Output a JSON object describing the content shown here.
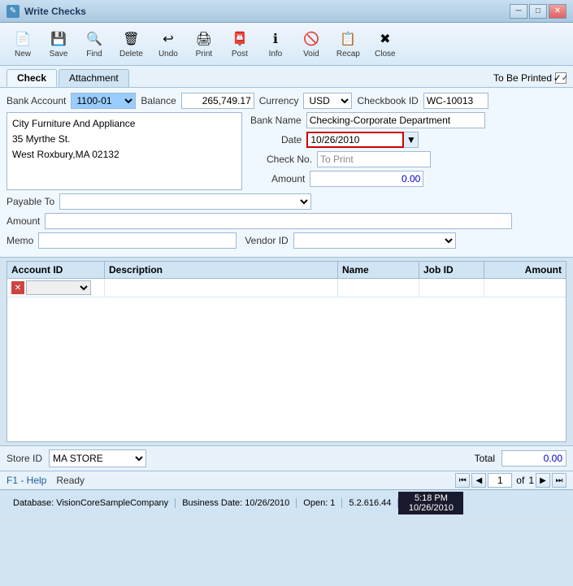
{
  "window": {
    "title": "Write Checks"
  },
  "toolbar": {
    "buttons": [
      {
        "id": "new",
        "label": "New",
        "icon": "📄"
      },
      {
        "id": "save",
        "label": "Save",
        "icon": "💾"
      },
      {
        "id": "find",
        "label": "Find",
        "icon": "🔍"
      },
      {
        "id": "delete",
        "label": "Delete",
        "icon": "🗑"
      },
      {
        "id": "undo",
        "label": "Undo",
        "icon": "↩"
      },
      {
        "id": "print",
        "label": "Print",
        "icon": "🖨"
      },
      {
        "id": "post",
        "label": "Post",
        "icon": "📮"
      },
      {
        "id": "info",
        "label": "Info",
        "icon": "ℹ"
      },
      {
        "id": "void",
        "label": "Void",
        "icon": "🚫"
      },
      {
        "id": "recap",
        "label": "Recap",
        "icon": "📋"
      },
      {
        "id": "close",
        "label": "Close",
        "icon": "✖"
      }
    ]
  },
  "tabs": [
    {
      "label": "Check",
      "active": true
    },
    {
      "label": "Attachment",
      "active": false
    }
  ],
  "to_be_printed": {
    "label": "To Be Printed",
    "checked": true
  },
  "form": {
    "bank_account_label": "Bank Account",
    "bank_account_value": "1100-01",
    "balance_label": "Balance",
    "balance_value": "265,749.17",
    "currency_label": "Currency",
    "currency_value": "USD",
    "checkbook_id_label": "Checkbook ID",
    "checkbook_id_value": "WC-10013",
    "address_lines": [
      "City Furniture And Appliance",
      "35 Myrthe St.",
      "West Roxbury,MA 02132"
    ],
    "bank_name_label": "Bank Name",
    "bank_name_value": "Checking-Corporate Department",
    "date_label": "Date",
    "date_value": "10/26/2010",
    "check_no_label": "Check No.",
    "check_no_value": "To Print",
    "amount_label": "Amount",
    "amount_value": "0.00",
    "payable_to_label": "Payable To",
    "payable_to_value": "",
    "amount_text_label": "Amount",
    "amount_text_value": "",
    "memo_label": "Memo",
    "memo_value": "",
    "vendor_id_label": "Vendor ID",
    "vendor_id_value": ""
  },
  "grid": {
    "headers": [
      "Account ID",
      "Description",
      "Name",
      "Job ID",
      "Amount"
    ],
    "rows": []
  },
  "bottom": {
    "store_id_label": "Store ID",
    "store_id_value": "MA STORE",
    "total_label": "Total",
    "total_value": "0.00"
  },
  "nav": {
    "help_label": "F1 - Help",
    "status_label": "Ready",
    "page_current": "1",
    "page_total": "1"
  },
  "status_bar": {
    "database_label": "Database: VisionCoreSampleCompany",
    "business_date_label": "Business Date: 10/26/2010",
    "open_label": "Open: 1",
    "version_label": "5.2.616.44"
  },
  "clock": {
    "time": "5:18 PM",
    "date": "10/26/2010"
  }
}
